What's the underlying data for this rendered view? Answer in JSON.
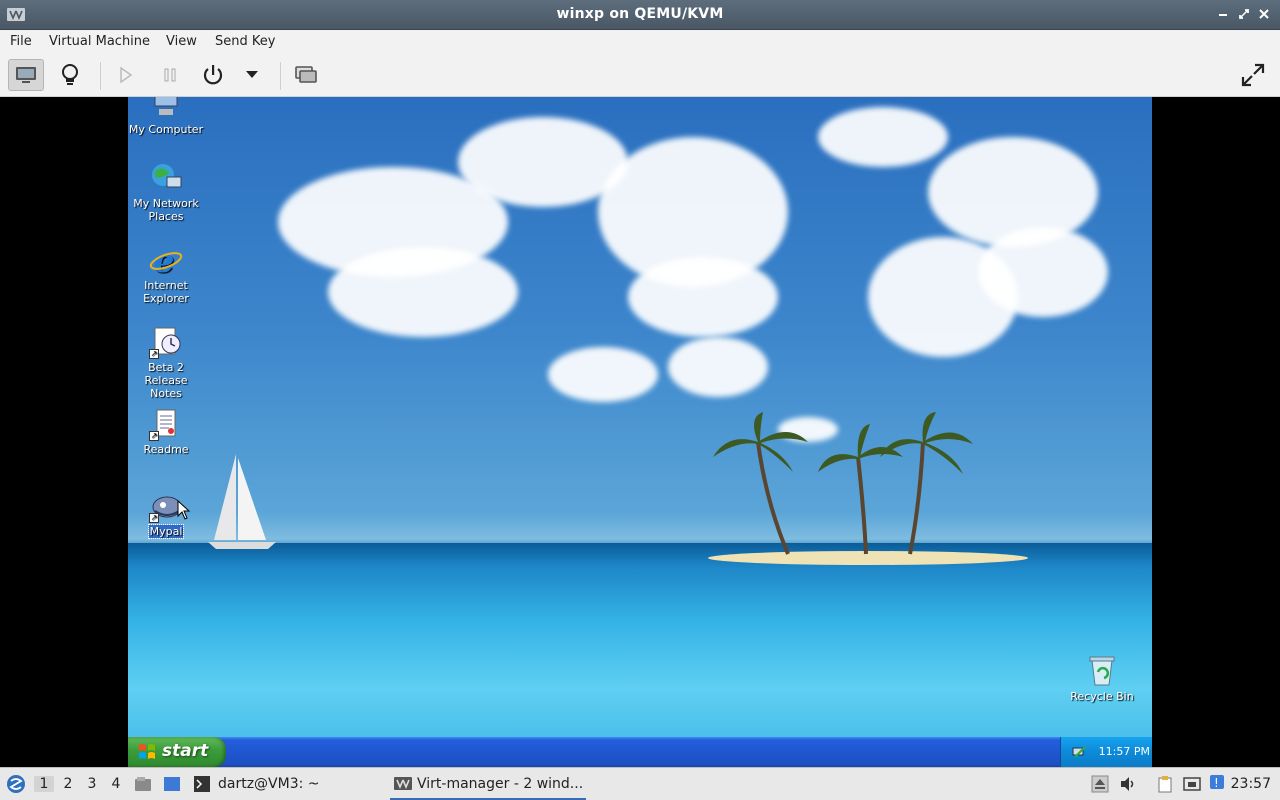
{
  "window": {
    "title": "winxp on QEMU/KVM",
    "menu": [
      "File",
      "Virtual Machine",
      "View",
      "Send Key"
    ]
  },
  "toolbar": {
    "buttons": [
      "console-icon",
      "lightbulb-icon",
      "play-icon",
      "pause-icon",
      "power-icon",
      "dropdown-arrow-icon",
      "snapshot-icon",
      "fullscreen-icon"
    ]
  },
  "guest": {
    "desktop_icons": [
      {
        "label": "My Computer",
        "icon": "computer-icon"
      },
      {
        "label": "My Network Places",
        "icon": "network-places-icon"
      },
      {
        "label": "Internet Explorer",
        "icon": "internet-explorer-icon"
      },
      {
        "label": "Beta 2 Release Notes",
        "icon": "release-notes-icon"
      },
      {
        "label": "Readme",
        "icon": "readme-icon"
      },
      {
        "label": "Mypal",
        "icon": "mypal-icon"
      },
      {
        "label": "Recycle Bin",
        "icon": "recycle-bin-icon"
      }
    ],
    "start_label": "start",
    "clock": "11:57 PM"
  },
  "panel": {
    "workspaces": [
      "1",
      "2",
      "3",
      "4"
    ],
    "current_workspace": "1",
    "tasks": [
      {
        "label": "dartz@VM3: ~",
        "icon": "terminal-icon"
      },
      {
        "label": "Virt-manager - 2 wind...",
        "icon": "virt-manager-icon"
      }
    ],
    "clock": "23:57"
  },
  "colors": {
    "titlebar": "#4f5e6c",
    "xp_taskbar": "#245edb",
    "start_button": "#3c9b3a",
    "selection": "#316ac5"
  }
}
